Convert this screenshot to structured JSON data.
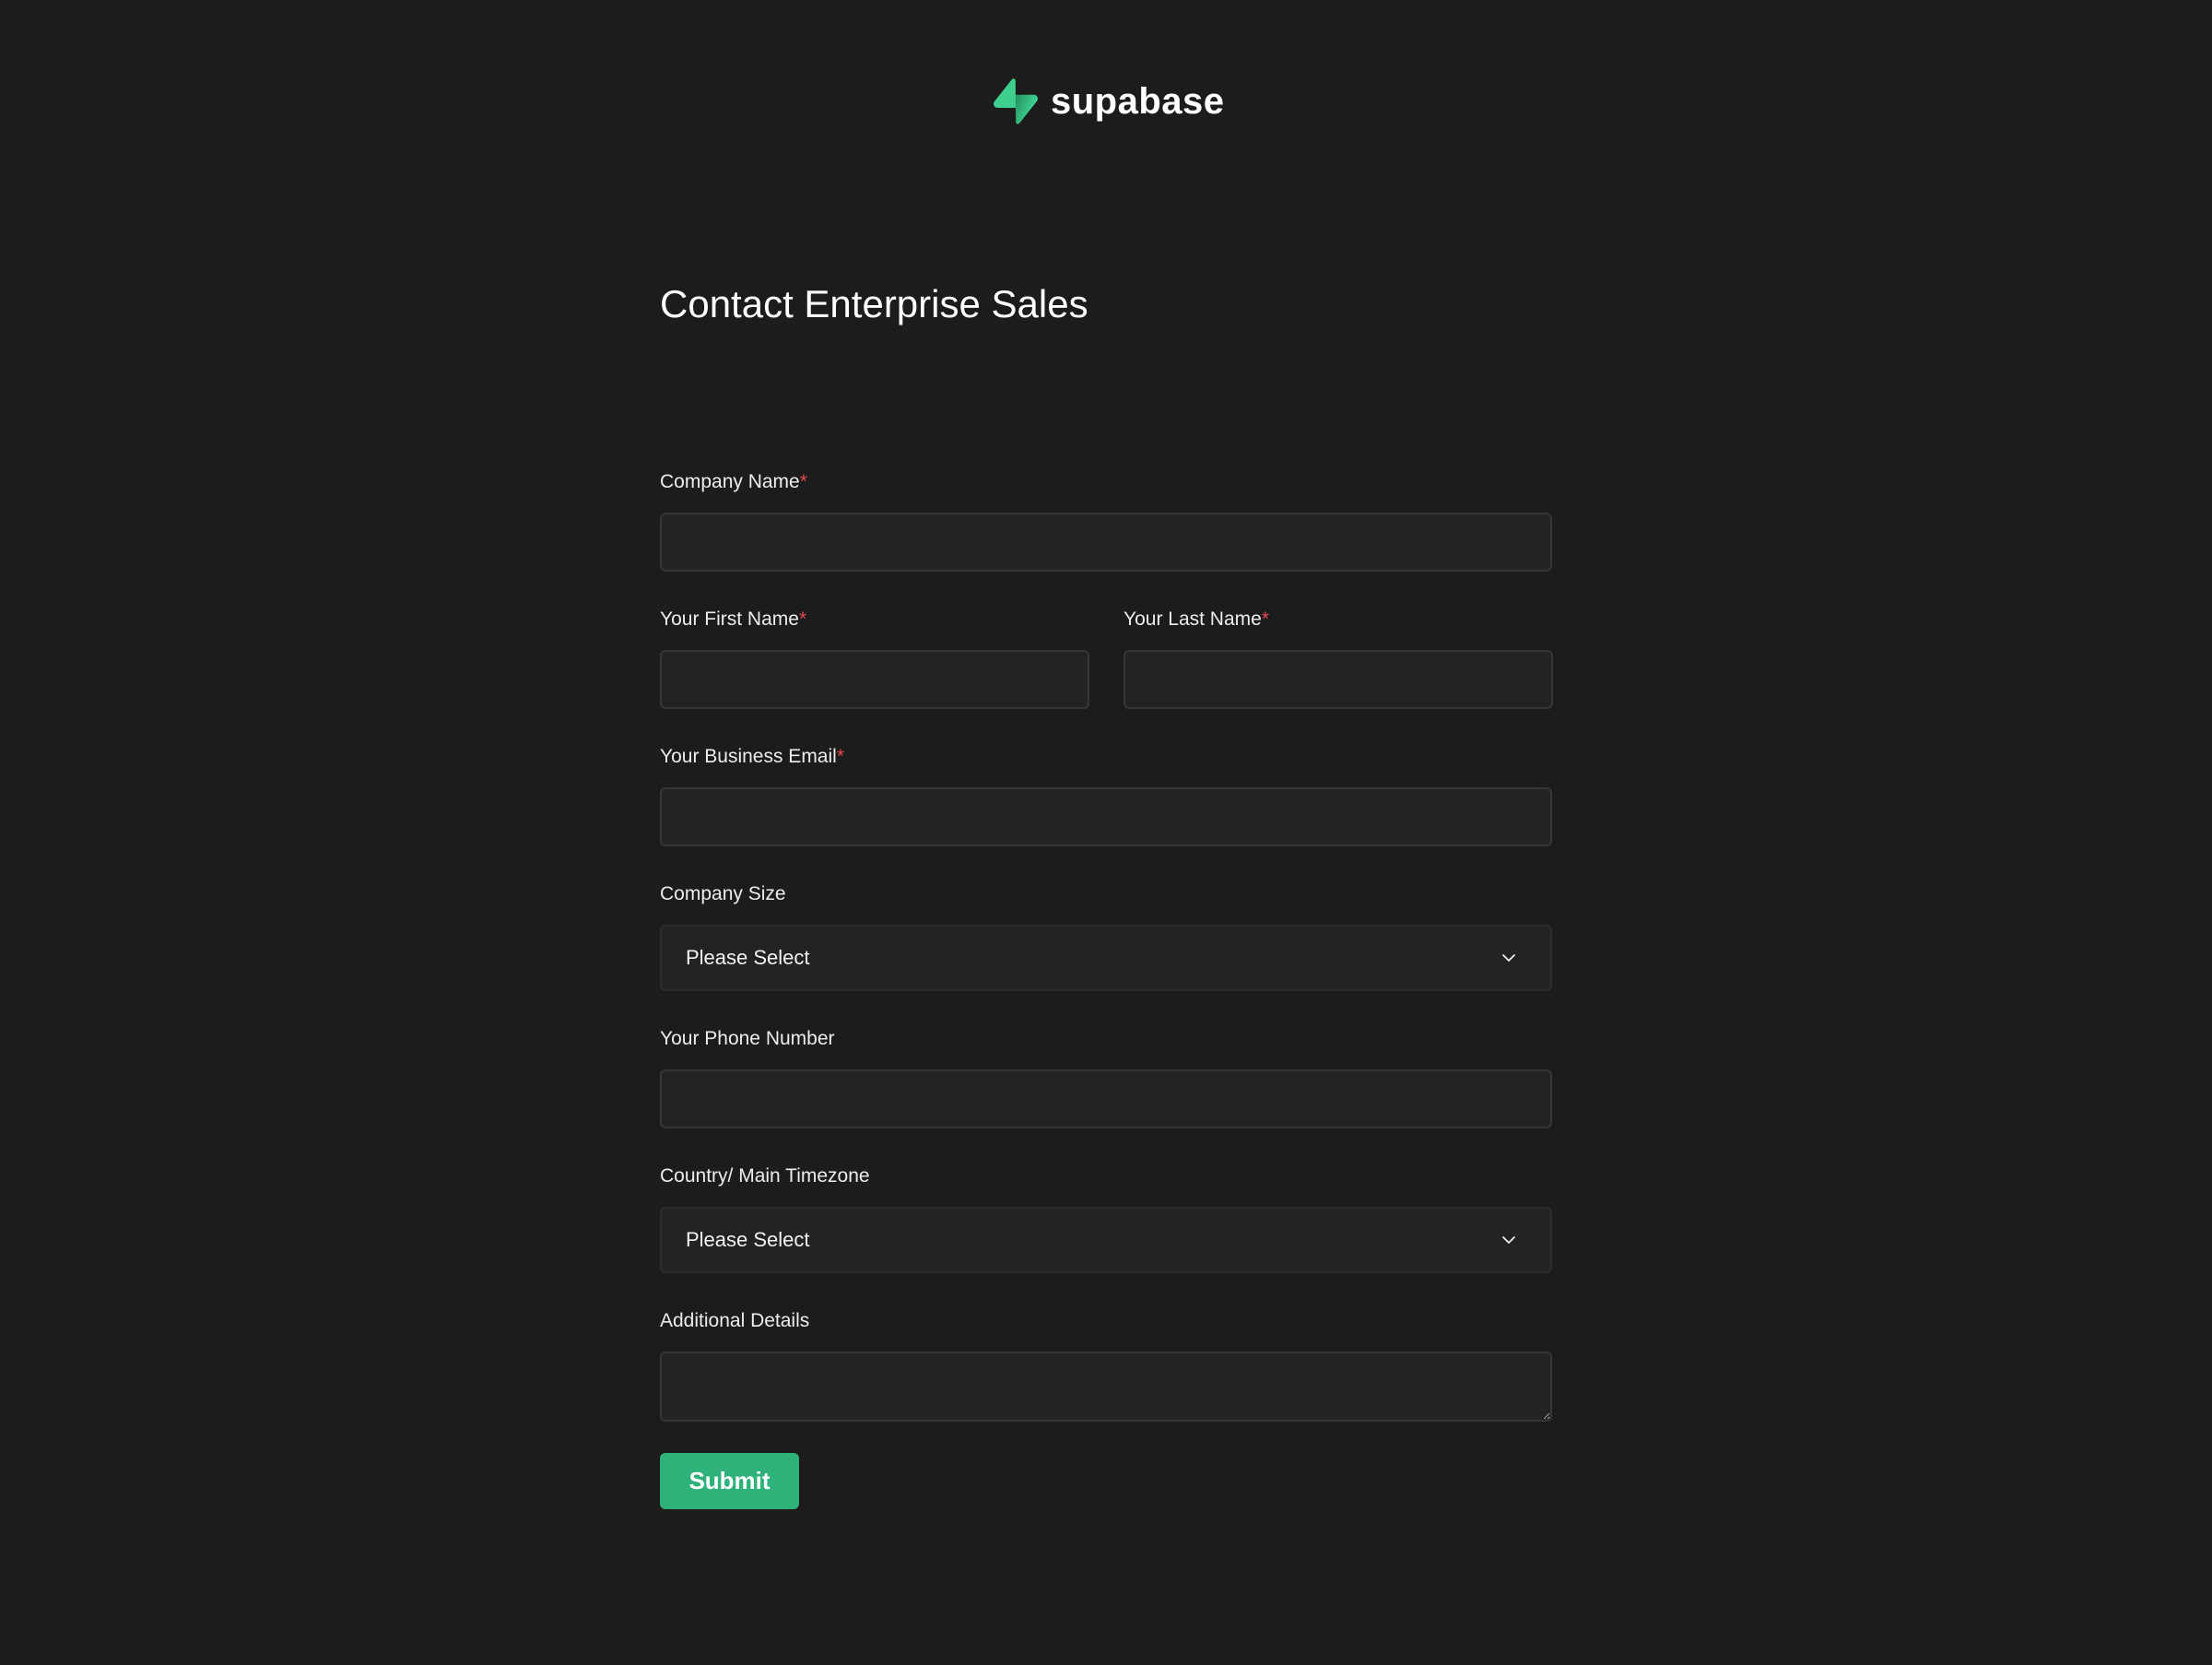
{
  "brand": {
    "name": "supabase",
    "icon": "supabase-bolt-icon",
    "accent": "#3ecf8e"
  },
  "page": {
    "title": "Contact Enterprise Sales"
  },
  "form": {
    "company_name": {
      "label": "Company Name",
      "required_mark": "*",
      "value": ""
    },
    "first_name": {
      "label": "Your First Name",
      "required_mark": "*",
      "value": ""
    },
    "last_name": {
      "label": "Your Last Name",
      "required_mark": "*",
      "value": ""
    },
    "business_email": {
      "label": "Your Business Email",
      "required_mark": "*",
      "value": ""
    },
    "company_size": {
      "label": "Company Size",
      "selected": "Please Select",
      "icon": "chevron-down-icon"
    },
    "phone_number": {
      "label": "Your Phone Number",
      "value": ""
    },
    "timezone": {
      "label": "Country/ Main Timezone",
      "selected": "Please Select",
      "icon": "chevron-down-icon"
    },
    "additional_details": {
      "label": "Additional Details",
      "value": ""
    },
    "submit_label": "Submit",
    "submit_color": "#2fb27a",
    "required_color": "#e5484d"
  }
}
